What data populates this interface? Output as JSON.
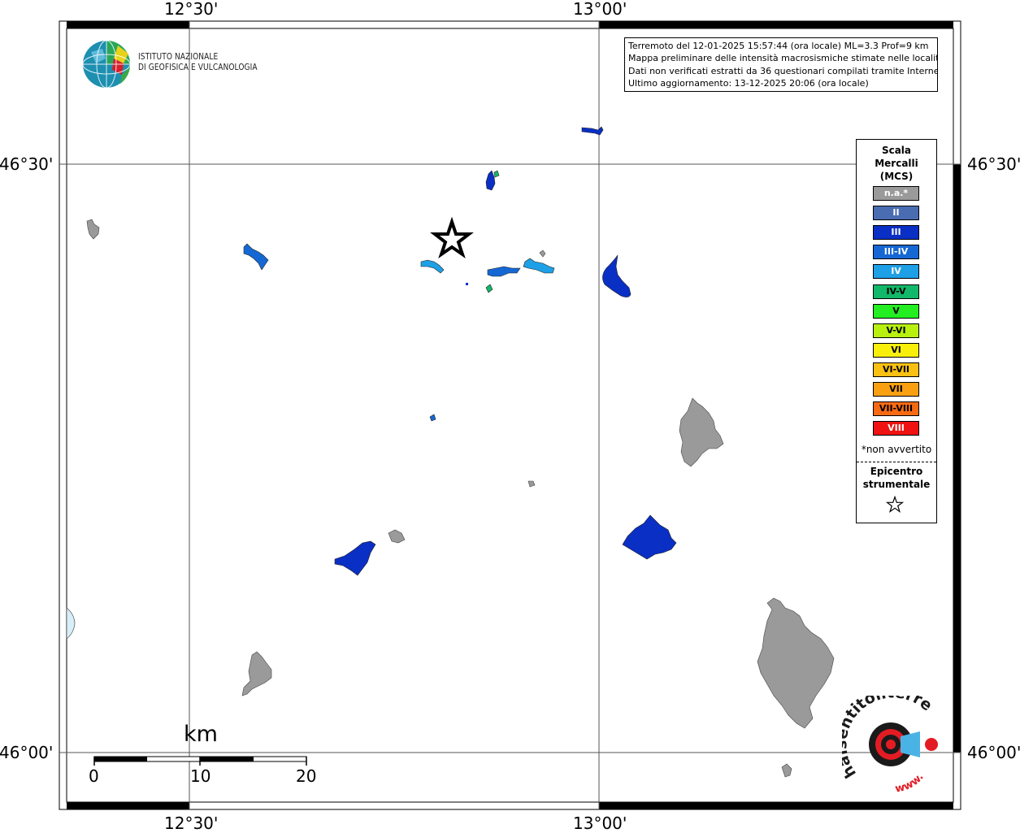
{
  "coordinates": {
    "top": [
      "12°30'",
      "13°00'"
    ],
    "bottom": [
      "12°30'",
      "13°00'"
    ],
    "left": [
      "46°30'",
      "46°00'"
    ],
    "right": [
      "46°30'",
      "46°00'"
    ]
  },
  "logo": {
    "line1": "ISTITUTO NAZIONALE",
    "line2": "DI GEOFISICA E VULCANOLOGIA"
  },
  "info": {
    "line1": "Terremoto del 12-01-2025 15:57:44 (ora locale) ML=3.3 Prof=9 km",
    "line2": "Mappa preliminare delle intensità macrosismiche stimate nelle località",
    "line3": "Dati non verificati estratti da 36 questionari compilati tramite Internet.",
    "line4": "Ultimo aggiornamento: 13-12-2025 20:06 (ora locale)"
  },
  "legend": {
    "title1": "Scala",
    "title2": "Mercalli",
    "title3": "(MCS)",
    "items": [
      {
        "label": "n.a.*",
        "color": "#9a9a9a",
        "text": "#ffffff"
      },
      {
        "label": "II",
        "color": "#4a6cb0",
        "text": "#ffffff"
      },
      {
        "label": "III",
        "color": "#0a2fc4",
        "text": "#ffffff"
      },
      {
        "label": "III-IV",
        "color": "#1568d4",
        "text": "#ffffff"
      },
      {
        "label": "IV",
        "color": "#1ea0e6",
        "text": "#ffffff"
      },
      {
        "label": "IV-V",
        "color": "#12b86a",
        "text": "#000000"
      },
      {
        "label": "V",
        "color": "#22ee22",
        "text": "#000000"
      },
      {
        "label": "V-VI",
        "color": "#b8f010",
        "text": "#000000"
      },
      {
        "label": "VI",
        "color": "#f8f00a",
        "text": "#000000"
      },
      {
        "label": "VI-VII",
        "color": "#f8c012",
        "text": "#000000"
      },
      {
        "label": "VII",
        "color": "#f8a012",
        "text": "#000000"
      },
      {
        "label": "VII-VIII",
        "color": "#f86a12",
        "text": "#000000"
      },
      {
        "label": "VIII",
        "color": "#ee1212",
        "text": "#ffffff"
      }
    ],
    "note": "*non avvertito",
    "epicenter1": "Epicentro",
    "epicenter2": "strumentale"
  },
  "scale": {
    "title": "km",
    "labels": [
      "0",
      "10",
      "20"
    ]
  },
  "colors": {
    "unfelt": "#9a9a9a",
    "ii": "#4a6cb0",
    "iii": "#0a2fc4",
    "iii_iv": "#1568d4",
    "iv": "#1ea0e6",
    "iv_v": "#12b86a"
  },
  "watermark": {
    "text": "haisentitoilterremoto.it",
    "prefix": "www."
  }
}
